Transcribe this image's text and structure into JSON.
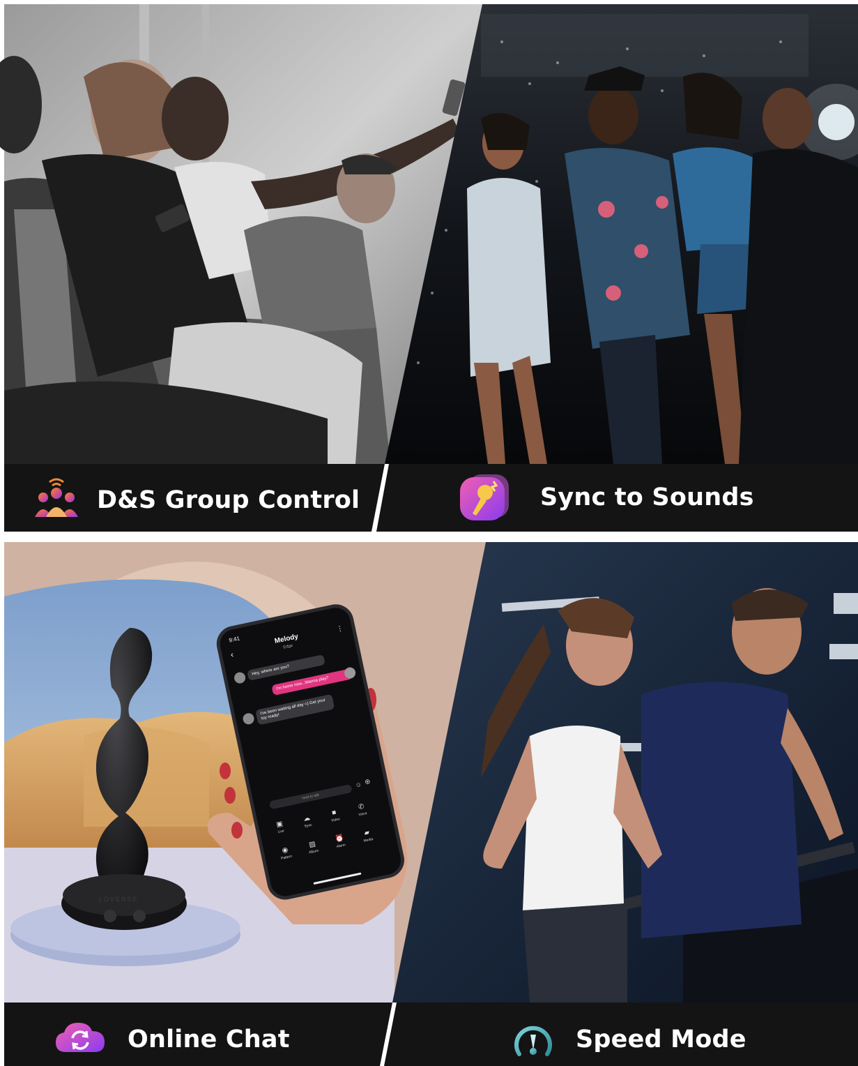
{
  "panels": [
    {
      "label": "D&S Group Control",
      "icon": "group-control-icon"
    },
    {
      "label": "Sync to Sounds",
      "icon": "microphone-sound-icon"
    },
    {
      "label": "Online Chat",
      "icon": "chat-sync-icon"
    },
    {
      "label": "Speed Mode",
      "icon": "speedometer-icon"
    }
  ],
  "phone": {
    "time": "9:41",
    "contact": "Melody",
    "contact_sub": "Edge",
    "messages": [
      "Hey, where are you?",
      "I'm home now...Wanna play?",
      "I've been waiting all day =) Get your toy ready!"
    ],
    "input_placeholder": "Hold to talk",
    "actions": [
      "Live",
      "Sync",
      "Video",
      "Voice",
      "Pattern",
      "Album",
      "Alarm",
      "Media"
    ]
  },
  "device": {
    "brand": "LOVENSE"
  },
  "colors": {
    "banner": "#141414",
    "accent_pink": "#e0367f",
    "accent_purple": "#8a3cf0",
    "accent_teal": "#3fa9b8",
    "accent_orange": "#f08a3a"
  }
}
